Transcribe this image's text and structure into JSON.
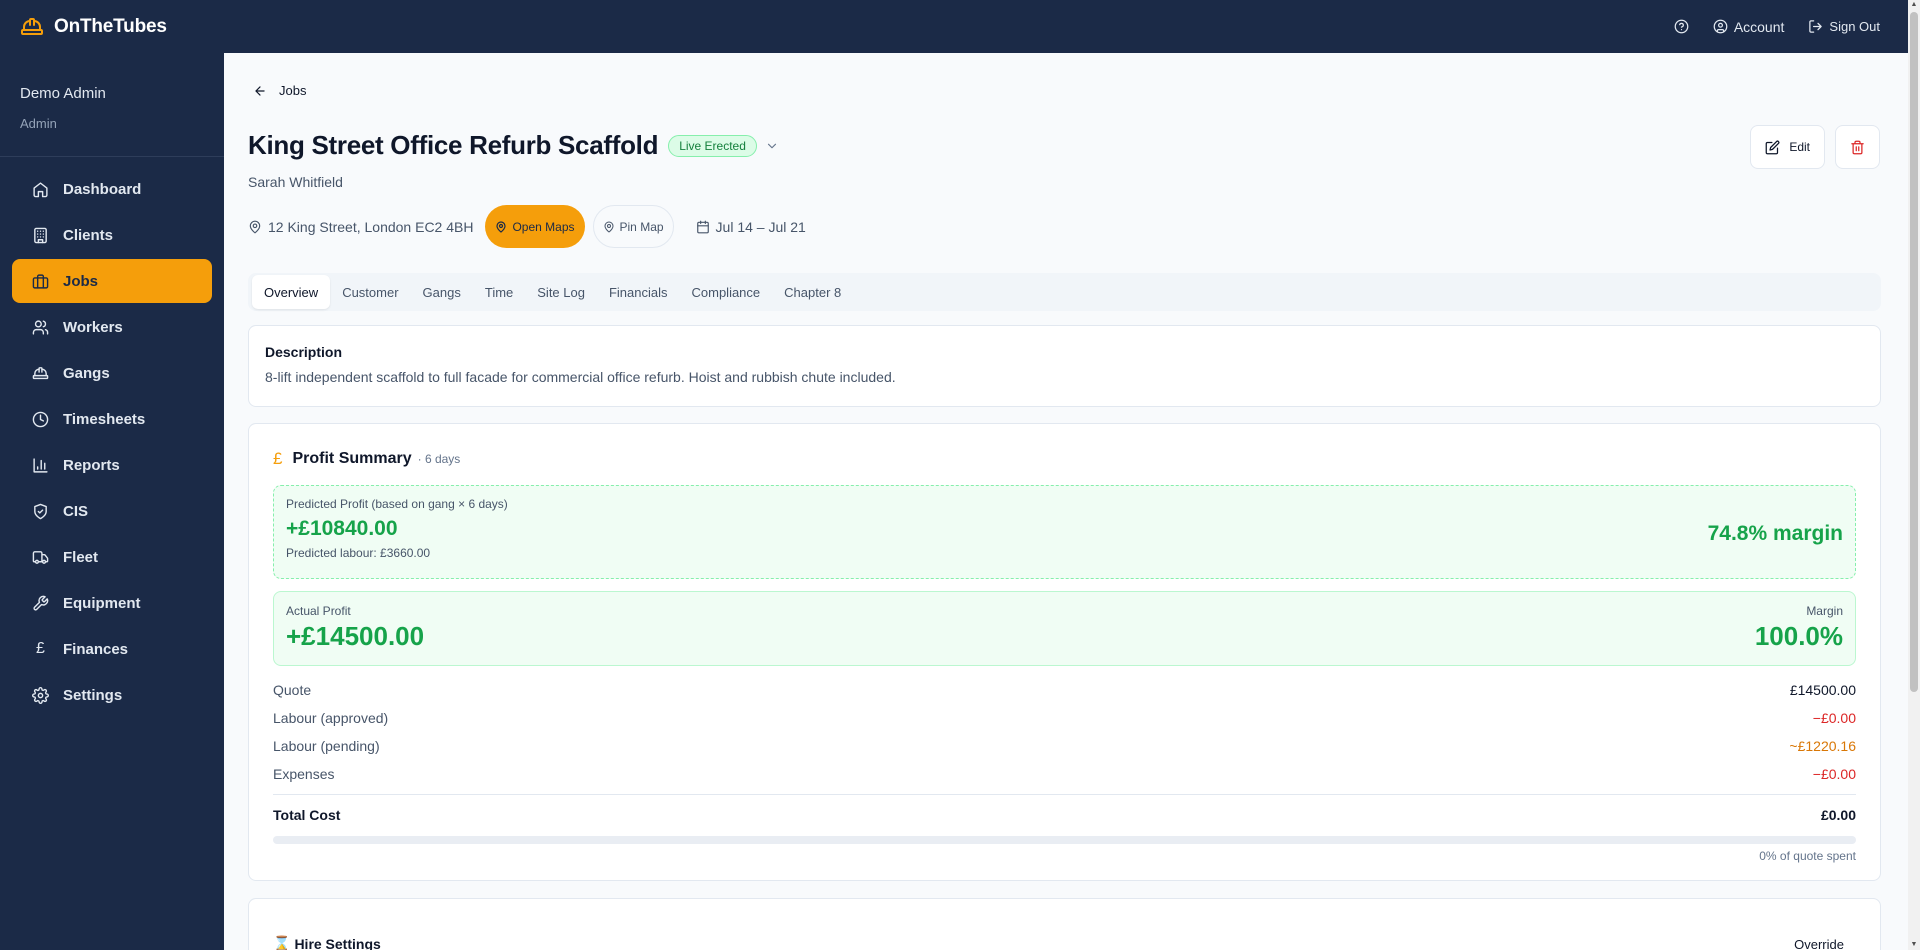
{
  "app": {
    "name": "OnTheTubes"
  },
  "user": {
    "name": "Demo Admin",
    "role": "Admin"
  },
  "nav": [
    {
      "label": "Dashboard",
      "icon": "home-icon"
    },
    {
      "label": "Clients",
      "icon": "building-icon"
    },
    {
      "label": "Jobs",
      "icon": "briefcase-icon",
      "active": true
    },
    {
      "label": "Workers",
      "icon": "users-icon"
    },
    {
      "label": "Gangs",
      "icon": "hardhat-icon"
    },
    {
      "label": "Timesheets",
      "icon": "clock-icon"
    },
    {
      "label": "Reports",
      "icon": "bar-chart-icon"
    },
    {
      "label": "CIS",
      "icon": "shield-icon"
    },
    {
      "label": "Fleet",
      "icon": "truck-icon"
    },
    {
      "label": "Equipment",
      "icon": "wrench-icon"
    },
    {
      "label": "Finances",
      "icon": "pound-icon"
    },
    {
      "label": "Settings",
      "icon": "gear-icon"
    }
  ],
  "topbar": {
    "account_label": "Account",
    "signout_label": "Sign Out"
  },
  "breadcrumb": {
    "back_label": "Jobs"
  },
  "job": {
    "title": "King Street Office Refurb Scaffold",
    "status": "Live Erected",
    "contact": "Sarah Whitfield",
    "address": "12 King Street, London EC2 4BH",
    "open_maps_label": "Open Maps",
    "pin_map_label": "Pin Map",
    "dates": "Jul 14 – Jul 21"
  },
  "actions": {
    "edit_label": "Edit"
  },
  "tabs": [
    "Overview",
    "Customer",
    "Gangs",
    "Time",
    "Site Log",
    "Financials",
    "Compliance",
    "Chapter 8"
  ],
  "active_tab": "Overview",
  "description": {
    "title": "Description",
    "text": "8-lift independent scaffold to full facade for commercial office refurb. Hoist and rubbish chute included."
  },
  "profit": {
    "title": "Profit Summary",
    "days_label": "· 6 days",
    "predicted_label": "Predicted Profit (based on gang × 6 days)",
    "predicted_value": "+£10840.00",
    "predicted_labour": "Predicted labour: £3660.00",
    "predicted_margin": "74.8% margin",
    "actual_label": "Actual Profit",
    "actual_value": "+£14500.00",
    "margin_label": "Margin",
    "margin_value": "100.0%",
    "lines": [
      {
        "label": "Quote",
        "value": "£14500.00",
        "tone": "dark"
      },
      {
        "label": "Labour (approved)",
        "value": "−£0.00",
        "tone": "red"
      },
      {
        "label": "Labour (pending)",
        "value": "~£1220.16",
        "tone": "amber"
      },
      {
        "label": "Expenses",
        "value": "−£0.00",
        "tone": "red"
      }
    ],
    "total_label": "Total Cost",
    "total_value": "£0.00",
    "spent_fraction": 0,
    "spent_label": "0% of quote spent"
  },
  "hire": {
    "title": "Hire Settings",
    "override_label": "Override"
  },
  "colors": {
    "navy": "#1b2a47",
    "amber": "#f59e0b",
    "green": "#16a34a",
    "red": "#dc2626"
  }
}
